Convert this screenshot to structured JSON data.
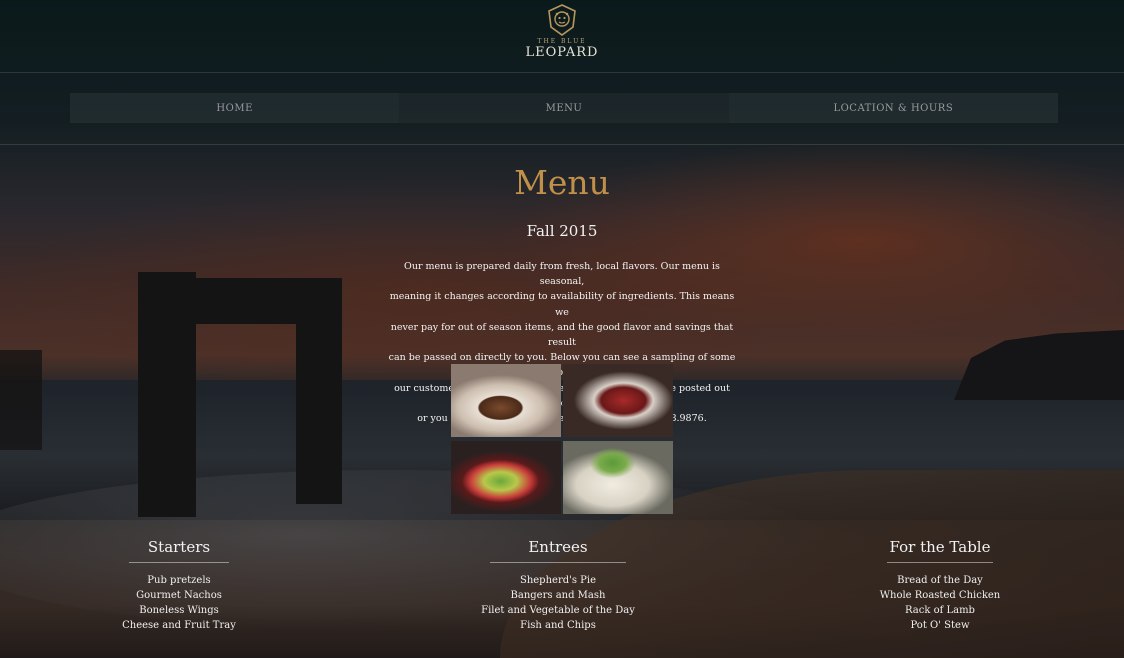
{
  "brand": {
    "logo_icon": "leopard-crest-icon",
    "small_text": "THE BLUE",
    "name": "LEOPARD",
    "accent_color": "#c0904a"
  },
  "nav": {
    "items": [
      {
        "label": "HOME"
      },
      {
        "label": "MENU"
      },
      {
        "label": "LOCATION & HOURS"
      }
    ]
  },
  "main": {
    "title": "Menu",
    "season": "Fall 2015",
    "intro_lines": [
      "Our menu is prepared daily from fresh, local flavors. Our menu is seasonal,",
      "meaning it changes according to availability of ingredients. This means we",
      "never pay for out of season items, and the good flavor and savings that result",
      "can be passed on directly to you. Below you can see a sampling of some of",
      "our customer's favorite dishes. Specials vary daily and are posted out front,",
      "or you may call to find out ahead of time at 1.555.678.9876."
    ]
  },
  "sections": [
    {
      "title": "Starters",
      "items": [
        "Pub pretzels",
        "Gourmet Nachos",
        "Boneless Wings",
        "Cheese and Fruit Tray"
      ]
    },
    {
      "title": "Entrees",
      "items": [
        "Shepherd's Pie",
        "Bangers and Mash",
        "Filet and Vegetable of the Day",
        "Fish and Chips"
      ]
    },
    {
      "title": "For the Table",
      "items": [
        "Bread of the Day",
        "Whole Roasted Chicken",
        "Rack of Lamb",
        "Pot O' Stew"
      ]
    }
  ]
}
